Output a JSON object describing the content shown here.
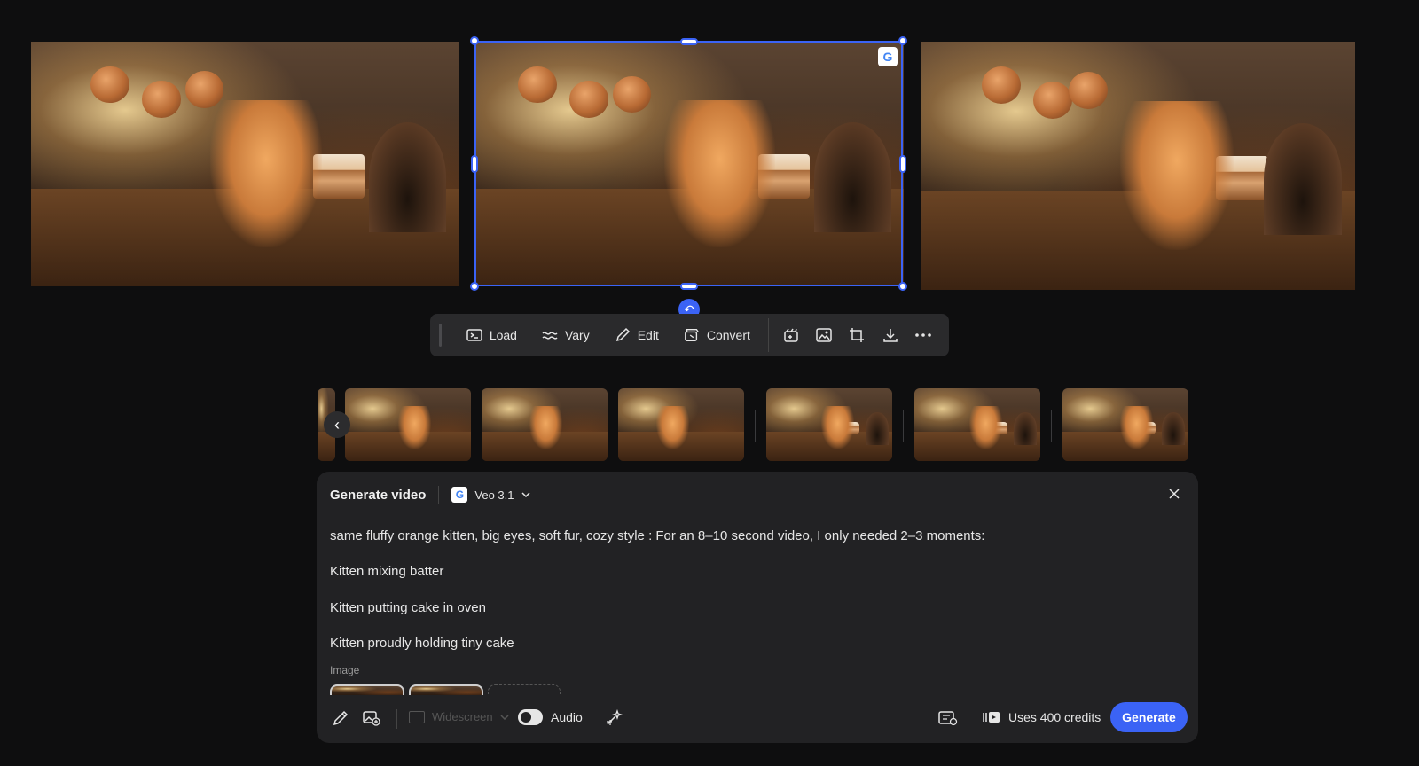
{
  "canvas": {
    "images": [
      {
        "name": "Kitten mixing batter"
      },
      {
        "name": "Kitten putting cake in oven"
      },
      {
        "name": "Kitten proudly holding tiny cake"
      }
    ],
    "selected_badge": "G",
    "accent_color": "#3b63f5"
  },
  "toolbar": {
    "load_label": "Load",
    "vary_label": "Vary",
    "edit_label": "Edit",
    "convert_label": "Convert"
  },
  "panel": {
    "title": "Generate video",
    "model_badge": "G",
    "model": "Veo 3.1",
    "prompt_lines": [
      "same fluffy orange kitten, big eyes, soft fur, cozy style :  For an 8–10 second video, I only needed 2–3 moments:",
      "Kitten mixing batter",
      "Kitten putting cake in oven",
      "Kitten proudly holding tiny cake"
    ],
    "image_label": "Image",
    "aspect_label": "Widescreen",
    "audio_label": "Audio",
    "audio_enabled": true,
    "credits_label": "Uses 400 credits",
    "generate_label": "Generate"
  },
  "icons": {
    "load": "load-icon",
    "vary": "vary-icon",
    "edit": "pencil-icon",
    "convert": "convert-icon",
    "close": "close-icon",
    "prev": "chevron-left-icon"
  }
}
